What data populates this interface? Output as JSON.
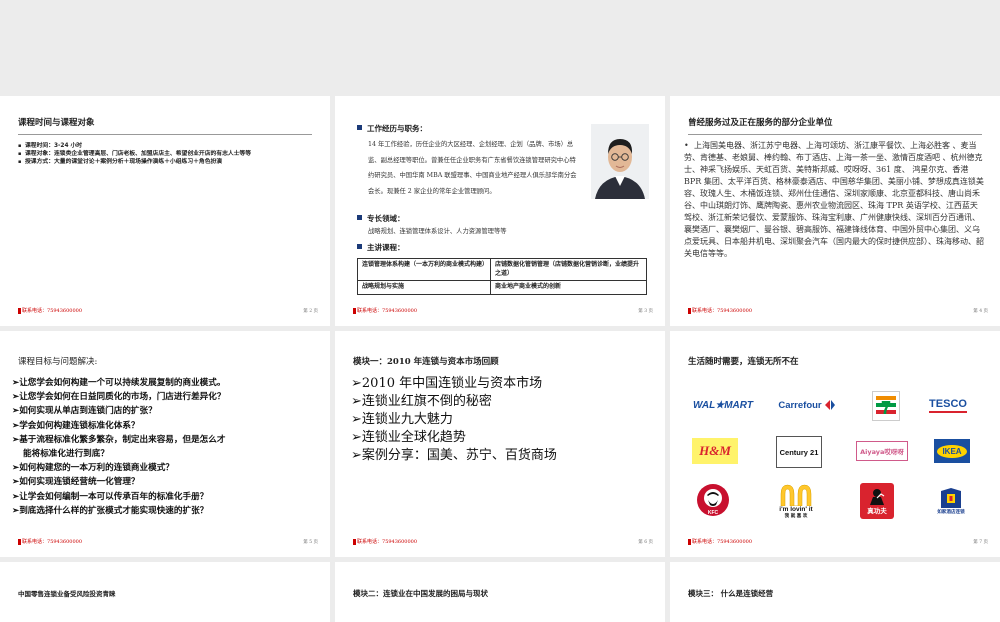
{
  "contact_label": "联系电话：",
  "contact_phone": "75943600000",
  "slides": [
    {
      "title": "课程时间与课程对象",
      "items": [
        "课程时间：3-24 小时",
        "课程对象：连锁类企业管理高层、门店老板、加盟店店主、希望创业开店的有志人士等等",
        "授课方式：大量的课堂讨论＋案例分析＋现场操作演练＋小组练习＋角色扮演"
      ],
      "page": "第 2 页"
    },
    {
      "work_heading": "工作经历与职务：",
      "bio": "14 年工作经验，历任企业的大区经理、企划经理、企划（品牌、市场）总监、副总经理等职位。曾兼任任企业职务有广东省餐饮连锁管理研究中心特约研究员、中国华南 MBA 联盟理事、中国商业地产经理人俱乐部华南分会会长。现兼任 2 家企业的常年企业管理顾问。",
      "skill_heading": "专长领域：",
      "skill": "战略规划、连锁管理体系设计、人力资源管理等等",
      "course_heading": "主讲课程：",
      "courses": [
        [
          "连锁管理体系构建（一本万利的商业模式构建）",
          "店铺数据化管销管理（店铺数据化营销诊断，业绩提升之道）"
        ],
        [
          "战略规划与实施",
          "商业地产商业模式的创新"
        ]
      ],
      "page": "第 3 页"
    },
    {
      "title": "曾经服务过及正在服务的部分企业单位",
      "text": "上海国美电器、浙江苏宁电器、上海可颂坊、浙江康平餐饮、上海必胜客 、麦当劳、肯德基、老娘舅、棒约翰、布丁酒店、上海一茶一坐、激情百度酒吧 、杭州德克士、神采飞扬娱乐、天虹百货、美特斯邦威、哎呀呀、361 度、 鸿星尔克、香港 BPR 集团、太平洋百货、格林豪泰酒店、中国慈华集团、美丽小铺、梦想成真连锁美容、玫瑰人生、木桶饭连锁、郑州仕佳通信、深圳家顺康、北京亚都科技、唐山尚禾谷、中山琪朗灯饰、鹰牌陶瓷、惠州农业物流园区、珠海 TPR 英语学校、江西蓝天驾校、浙江新荣记餐饮、爱蒙服饰、珠海宝利康、广州健康快线、深圳百分百通讯、襄樊酒厂、襄樊烟厂、曼谷银、碧高服饰、福建锋线体育、中国外贸中心集团、义乌点爱玩具、日本船井机电、深圳聚会汽车（国内最大的保时捷供应部）、珠海移动、韶关电信等等。",
      "page": "第 4 页"
    },
    {
      "title": "课程目标与问题解决:",
      "items": [
        "让您学会如何构建一个可以持续发展复制的商业模式。",
        "让您学会如何在日益同质化的市场，门店进行差异化？",
        "如何实现从单店到连锁门店的扩张？",
        "学会如何构建连锁标准化体系？",
        "基于流程标准化繁多繁杂，制定出来容易，但是怎么才",
        "能将标准化进行到底？",
        "如何构建您的一本万利的连锁商业模式？",
        "如何实现连锁经营统一化管理？",
        "让学会如何编制一本可以传承百年的标准化手册？",
        "到底选择什么样的扩张模式才能实现快速的扩张？"
      ],
      "page": "第 5 页"
    },
    {
      "title": "模块一：2010 年连锁与资本市场回顾",
      "items": [
        "2010 年中国连锁业与资本市场",
        "连锁业红旗不倒的秘密",
        "连锁业九大魅力",
        "连锁业全球化趋势",
        "案例分享：国美、苏宁、百货商场"
      ],
      "page": "第 6 页"
    },
    {
      "title": "生活随时需要，连锁无所不在",
      "logos": {
        "walmart": "WAL★MART",
        "carrefour": "Carrefour",
        "seven_eleven": "7",
        "tesco": "TESCO",
        "hm": "H&M",
        "century21": "Century 21",
        "aiyaya": "Aiyaya哎呀呀",
        "ikea": "IKEA",
        "kfc": "KFC",
        "mcd_slogan": "i'm lovin' it",
        "mcd_sub": "我 就 喜 欢",
        "zhengongfu": "真功夫",
        "rujia": "如家酒店连锁"
      },
      "page": "第 7 页"
    },
    {
      "title": "中国零售连锁业备受风险投资青睐"
    },
    {
      "title": "模块二：连锁业在中国发展的困局与现状"
    },
    {
      "title": "模块三：  什么是连锁经营"
    }
  ]
}
